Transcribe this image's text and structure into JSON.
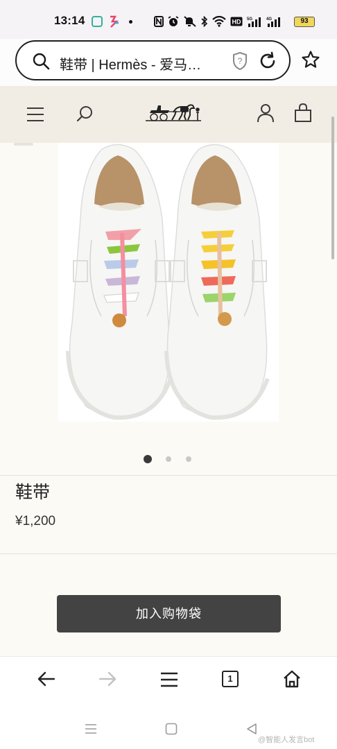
{
  "status_bar": {
    "time": "13:14",
    "battery": "93"
  },
  "address_bar": {
    "url_text": "鞋带 | Hermès - 爱马…",
    "icons": [
      "search-icon",
      "shield-question-icon",
      "reload-icon",
      "star-icon"
    ]
  },
  "site_header": {
    "icons": [
      "menu-icon",
      "search-icon",
      "hermes-logo",
      "account-icon",
      "shopping-bag-icon"
    ]
  },
  "product": {
    "name": "鞋带",
    "price": "¥1,200",
    "image_count": 3,
    "active_image": 1
  },
  "add_to_bag_label": "加入购物袋",
  "browser_bar": {
    "tab_count": "1",
    "icons": [
      "back-arrow-icon",
      "forward-arrow-icon",
      "menu-icon",
      "tabs-icon",
      "home-icon"
    ]
  },
  "system_nav": {
    "watermark": "@智能人发言bot"
  }
}
